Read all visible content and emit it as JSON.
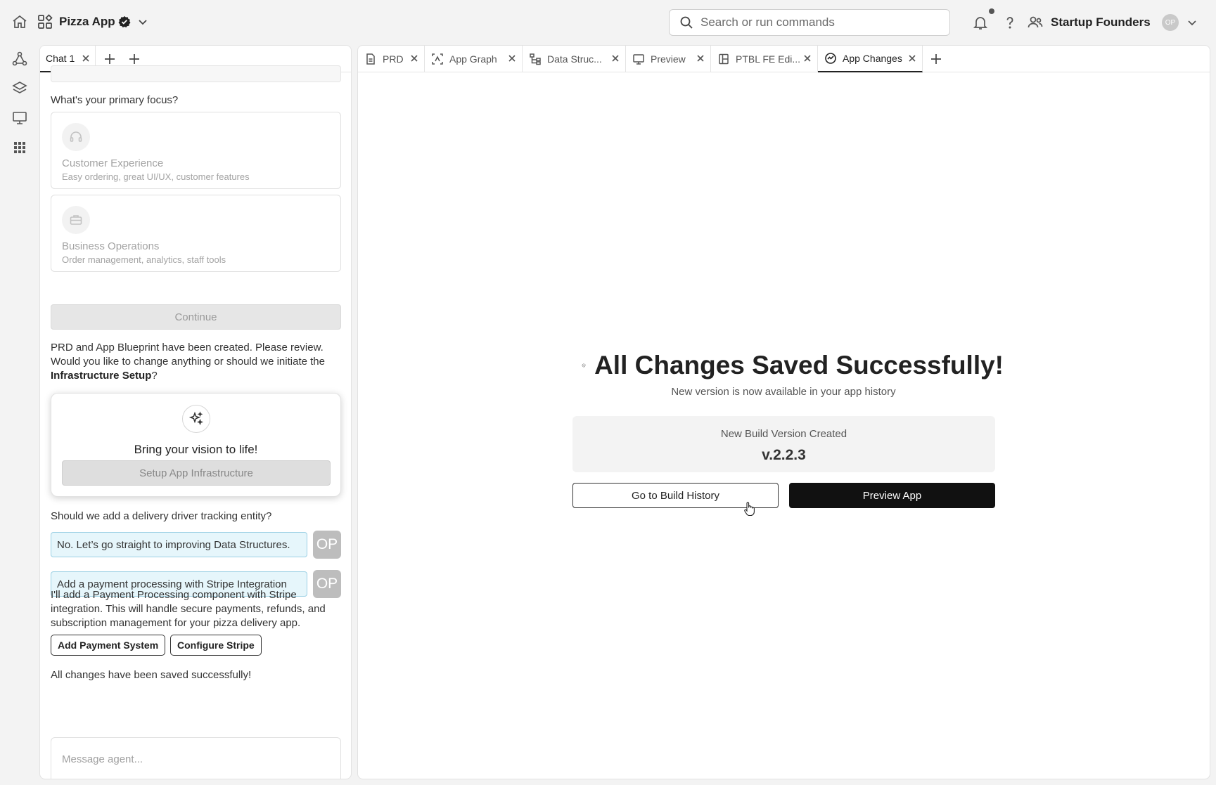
{
  "topbar": {
    "app_name": "Pizza App",
    "search_placeholder": "Search or run commands",
    "team_name": "Startup Founders",
    "avatar_initials": "OP"
  },
  "chat": {
    "tab_label": "Chat 1",
    "focus_question": "What's your primary focus?",
    "options": [
      {
        "title": "Customer Experience",
        "description": "Easy ordering, great UI/UX, customer features",
        "icon": "headset-icon"
      },
      {
        "title": "Business Operations",
        "description": "Order management, analytics, staff tools",
        "icon": "briefcase-icon"
      }
    ],
    "continue_label": "Continue",
    "prd_text_1": "PRD and App Blueprint have been created. Please review. Would you like to change anything or should we initiate the ",
    "prd_text_bold": "Infrastructure Setup",
    "prd_text_2": "?",
    "infra_card": {
      "title": "Bring your vision to life!",
      "button_label": "Setup App Infrastructure"
    },
    "driver_question": "Should we add a delivery driver tracking entity?",
    "user_messages": [
      {
        "text": "No. Let’s go straight to improving Data Structures.",
        "badge": "OP"
      },
      {
        "text": "Add a payment processing with Stripe Integration",
        "badge": "OP"
      }
    ],
    "agent_reply": "I'll add a Payment Processing component with Stripe integration. This will handle secure payments, refunds, and subscription management for your pizza delivery app.",
    "action_buttons": [
      "Add Payment System",
      "Configure Stripe"
    ],
    "saved_text": "All changes have been saved successfully!",
    "message_placeholder": "Message agent..."
  },
  "right_tabs": [
    {
      "label": "PRD",
      "icon": "document-icon"
    },
    {
      "label": "App Graph",
      "icon": "graph-frame-icon"
    },
    {
      "label": "Data Struc...",
      "icon": "hierarchy-icon"
    },
    {
      "label": "Preview",
      "icon": "monitor-icon"
    },
    {
      "label": "PTBL FE Edi...",
      "icon": "layout-icon"
    },
    {
      "label": "App Changes",
      "icon": "changes-icon",
      "active": true
    }
  ],
  "main": {
    "title": "All Changes Saved Successfully!",
    "subtitle": "New version is now available in your app history",
    "build_label": "New Build Version Created",
    "build_version": "v.2.2.3",
    "history_button": "Go to Build History",
    "preview_button": "Preview App"
  },
  "colors": {
    "accent_dark": "#111111",
    "user_msg_bg": "#e6f6fb",
    "user_msg_border": "#9bd0e4",
    "badge_gray": "#bdbdbd"
  }
}
